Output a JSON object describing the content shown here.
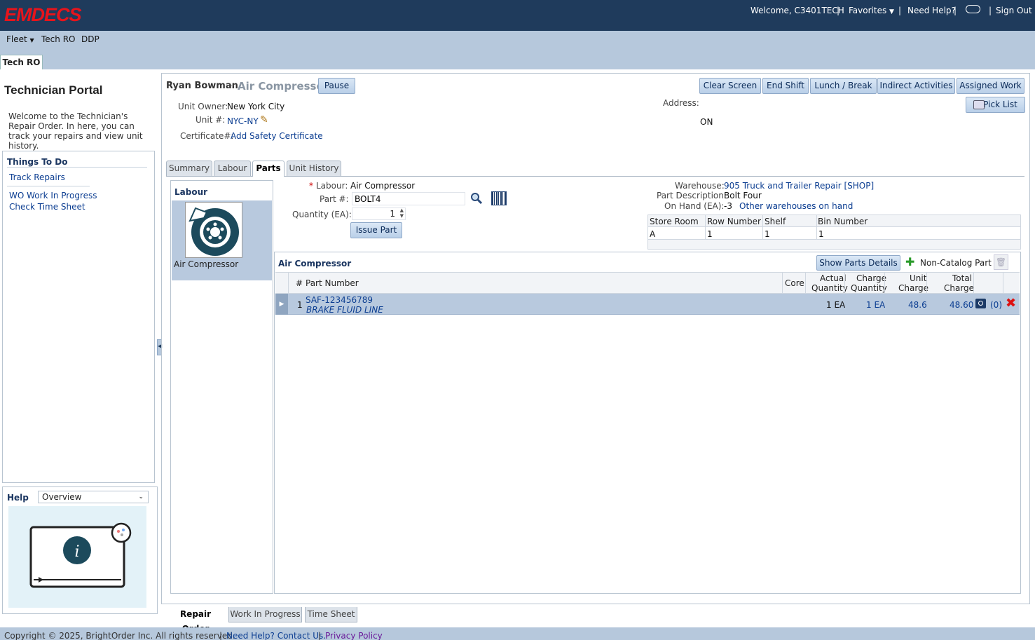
{
  "header": {
    "logo": "EMDECS",
    "welcome": "Welcome, C3401TECH",
    "favorites": "Favorites",
    "need_help": "Need Help?",
    "sign_out": "Sign Out"
  },
  "menu": {
    "fleet": "Fleet",
    "tech_ro": "Tech RO",
    "ddp": "DDP"
  },
  "page_tab": "Tech RO",
  "left": {
    "title": "Technician Portal",
    "intro": "Welcome to the Technician's Repair Order. In here, you can track your repairs and view unit history.",
    "todo_title": "Things To Do",
    "track_repairs": "Track Repairs",
    "wo_in_progress": "WO Work In Progress",
    "check_time_sheet": "Check Time Sheet",
    "help_label": "Help",
    "help_select": "Overview"
  },
  "ro": {
    "tech_name": "Ryan Bowman",
    "separator": "-",
    "job": "Air Compressor",
    "pause": "Pause",
    "buttons": {
      "clear_screen": "Clear Screen",
      "end_shift": "End Shift",
      "lunch_break": "Lunch / Break",
      "indirect": "Indirect Activities",
      "assigned": "Assigned Work",
      "pick_list": "Pick List"
    },
    "unit_owner_label": "Unit Owner:",
    "unit_owner": "New York City",
    "unit_label": "Unit #:",
    "unit": "NYC-NY",
    "cert_label": "Certificate#:",
    "cert_link": "Add Safety Certificate",
    "address_label": "Address:",
    "address_state": "ON"
  },
  "tabs": [
    "Summary",
    "Labour",
    "Parts",
    "Unit History"
  ],
  "labour_panel": {
    "title": "Labour",
    "item": "Air Compressor"
  },
  "issue": {
    "required_mark": "*",
    "labour_label": "Labour:",
    "labour": "Air Compressor",
    "part_label": "Part #:",
    "part_value": "BOLT4",
    "qty_label": "Quantity (EA):",
    "qty_value": "1",
    "issue_button": "Issue Part",
    "warehouse_label": "Warehouse:",
    "warehouse": "905 Truck and Trailer Repair [SHOP]",
    "desc_label": "Part Description:",
    "desc": "Bolt Four",
    "onhand_label": "On Hand (EA):",
    "onhand": "-3",
    "other_wh": "Other warehouses on hand",
    "loc_headers": [
      "Store Room",
      "Row Number",
      "Shelf",
      "Bin Number"
    ],
    "loc_row": [
      "A",
      "1",
      "1",
      "1"
    ]
  },
  "parts": {
    "title": "Air Compressor",
    "show_details": "Show Parts Details",
    "non_catalog": "Non-Catalog Part",
    "headers": {
      "num": "#",
      "part_number": "Part Number",
      "core": "Core",
      "actual_qty_1": "Actual",
      "actual_qty_2": "Quantity",
      "charge_qty_1": "Charge",
      "charge_qty_2": "Quantity",
      "unit_charge_1": "Unit",
      "unit_charge_2": "Charge",
      "total_charge_1": "Total",
      "total_charge_2": "Charge"
    },
    "rows": [
      {
        "num": "1",
        "part_number": "SAF-123456789",
        "description": "BRAKE FLUID LINE",
        "core": "",
        "actual_qty": "1 EA",
        "charge_qty": "1 EA",
        "unit_charge": "48.6",
        "total_charge": "48.60",
        "photos": "(0)"
      }
    ]
  },
  "bottom_tabs": [
    "Repair Order",
    "Work In Progress",
    "Time Sheet"
  ],
  "footer": {
    "copyright": "Copyright © 2025, BrightOrder Inc. All rights reserved.",
    "help_link": "Need Help? Contact Us.",
    "privacy": "Privacy Policy"
  },
  "colors": {
    "header_bg": "#1f3b5c",
    "logo": "#e8141b",
    "band": "#b6c8dc",
    "link": "#0b3d91",
    "selected_row": "#b8c9de"
  }
}
